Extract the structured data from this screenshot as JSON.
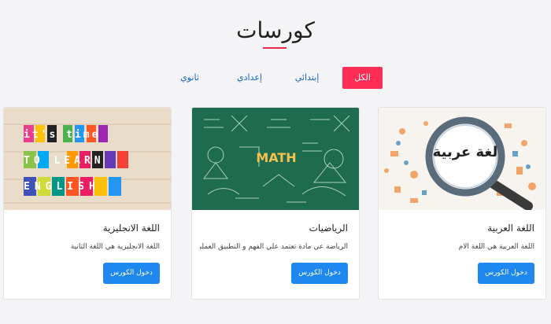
{
  "header": {
    "title": "كورسات"
  },
  "filters": [
    "الكل",
    "إبتدائي",
    "إعدادي",
    "ثانوي"
  ],
  "courses": [
    {
      "title": "اللغة العربية",
      "description": "اللغة العربية هي اللغة الام",
      "button": "دخول الكورس",
      "image_text": "لغة عربية"
    },
    {
      "title": "الرياضيات",
      "description": "الرياضة عي مادة تعتمد علي الفهم و التطبيق العملي",
      "button": "دخول الكورس",
      "image_text": "MATH"
    },
    {
      "title": "اللغة الانجليزية",
      "description": "اللغة الانجليزية هي اللغة الثانية",
      "button": "دخول الكورس",
      "image_text": [
        "it's time",
        "to learn",
        "english"
      ]
    }
  ],
  "colors": {
    "accent": "#ff2d55",
    "button": "#1e87f0",
    "link": "#1565c0"
  }
}
